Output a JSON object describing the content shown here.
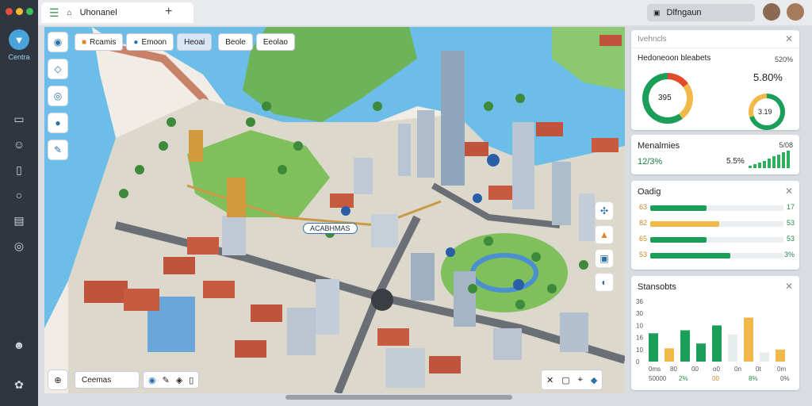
{
  "window": {
    "dots": [
      "#e94b3c",
      "#f5b82e",
      "#3fbf5a"
    ]
  },
  "sidebar": {
    "logo_label": "Centra"
  },
  "tab": {
    "title": "Uhonanel",
    "plus": "+"
  },
  "address": {
    "text": "Dlfngaun",
    "icon": "lock-icon"
  },
  "map_toolbar": {
    "pills": [
      {
        "label": "Rcamis",
        "icon": "orange-square-icon"
      },
      {
        "label": "Emoon",
        "icon": "blue-pin-icon"
      },
      {
        "label": "Heoai",
        "active": true
      },
      {
        "label": "Beole"
      },
      {
        "label": "Eeolao"
      }
    ]
  },
  "map": {
    "labels": [
      {
        "text": "ACABHMAS"
      }
    ],
    "search_label": "Ceemas"
  },
  "panel_donuts": {
    "header": "Ivehncls",
    "title": "Hedoneoon bleabets",
    "pct_top": "520%",
    "donut1_value": "395",
    "donut2_big": "5.80%",
    "donut2_value": "3.19",
    "colors": [
      "#1a9e5a",
      "#f0b94a",
      "#e04b2d"
    ]
  },
  "panel_mini": {
    "title": "Menalmies",
    "left_value": "12/3%",
    "right_value": "5.5%",
    "top_small": "5/08",
    "bars": [
      3,
      5,
      7,
      9,
      11,
      14,
      16,
      19,
      21
    ]
  },
  "panel_bars": {
    "title": "Oadig",
    "rows": [
      {
        "label": "63",
        "value": "17",
        "frac": 0.42,
        "color": "#1a9e5a"
      },
      {
        "label": "82",
        "value": "53",
        "frac": 0.52,
        "color": "#f0b94a"
      },
      {
        "label": "65",
        "value": "53",
        "frac": 0.42,
        "color": "#1a9e5a"
      },
      {
        "label": "53",
        "value": "3%",
        "frac": 0.6,
        "color": "#1a9e5a"
      }
    ]
  },
  "panel_chart": {
    "title": "Stansobts",
    "ylabels": [
      "36",
      "30",
      "10",
      "16",
      "10",
      "0"
    ],
    "xlabels_top": [
      "0ms",
      "80",
      "00",
      "o0",
      "0n",
      "0t",
      "0m"
    ],
    "xlabels_bottom": [
      "50000",
      "2%",
      "00",
      "8%",
      "0%"
    ],
    "bars": [
      {
        "v": 0.47,
        "c": "#1a9e5a"
      },
      {
        "v": 0.22,
        "c": "#f0b94a"
      },
      {
        "v": 0.52,
        "c": "#1a9e5a"
      },
      {
        "v": 0.3,
        "c": "#1a9e5a"
      },
      {
        "v": 0.6,
        "c": "#1a9e5a"
      },
      {
        "v": 0.45,
        "c": "#e6ecec"
      },
      {
        "v": 0.73,
        "c": "#f0b94a"
      },
      {
        "v": 0.15,
        "c": "#e6ecec"
      },
      {
        "v": 0.2,
        "c": "#f0b94a"
      }
    ]
  }
}
